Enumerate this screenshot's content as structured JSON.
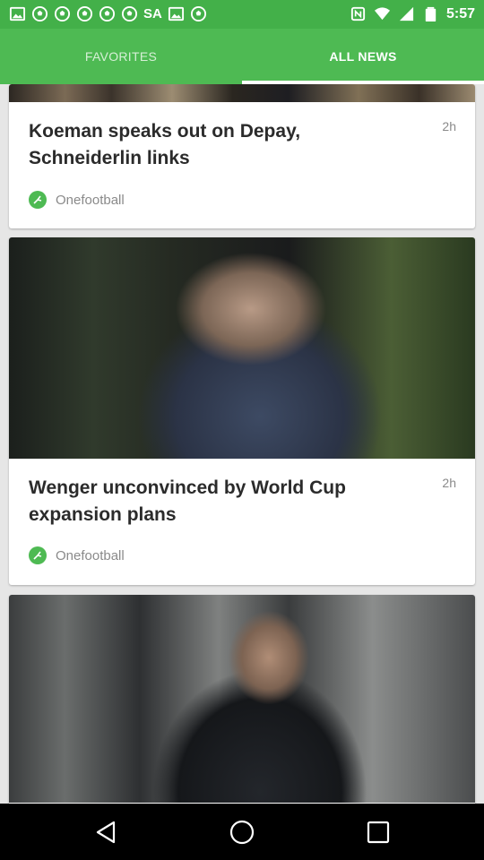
{
  "status_bar": {
    "carrier_label": "SA",
    "time": "5:57",
    "icons": [
      "image-icon",
      "soccer-ball-icon",
      "soccer-ball-icon",
      "soccer-ball-icon",
      "soccer-ball-icon",
      "soccer-ball-icon",
      "nfc-icon",
      "wifi-icon",
      "signal-icon",
      "battery-icon"
    ]
  },
  "tabs": [
    {
      "label": "FAVORITES",
      "active": false
    },
    {
      "label": "ALL NEWS",
      "active": true
    }
  ],
  "articles": [
    {
      "headline": "Koeman speaks out on Depay, Schneiderlin links",
      "age": "2h",
      "source": "Onefootball"
    },
    {
      "headline": "Wenger unconvinced by World Cup expansion plans",
      "age": "2h",
      "source": "Onefootball"
    },
    {
      "headline": "",
      "age": "",
      "source": ""
    }
  ],
  "nav_bar": {
    "buttons": [
      "back-icon",
      "home-icon",
      "recents-icon"
    ]
  },
  "colors": {
    "status_bar": "#43b049",
    "tab_bar": "#4eba53",
    "feed_background": "#e6e6e6",
    "accent": "#4eba53"
  }
}
